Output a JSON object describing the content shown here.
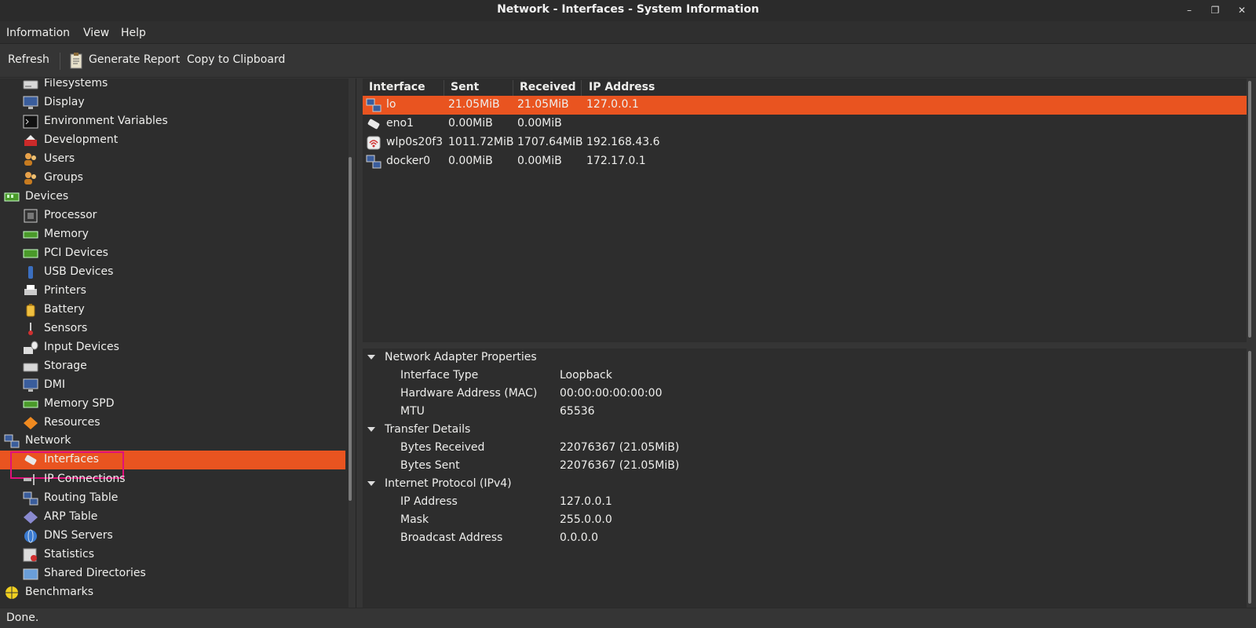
{
  "window": {
    "title": "Network - Interfaces - System Information"
  },
  "menubar": {
    "items": [
      "Information",
      "View",
      "Help"
    ]
  },
  "toolbar": {
    "refresh": "Refresh",
    "generate_report": "Generate Report",
    "copy_clipboard": "Copy to Clipboard"
  },
  "sidebar": {
    "items": [
      {
        "label": "Filesystems",
        "icon": "filesystem-icon",
        "level": 1
      },
      {
        "label": "Display",
        "icon": "display-icon",
        "level": 1
      },
      {
        "label": "Environment Variables",
        "icon": "terminal-icon",
        "level": 1
      },
      {
        "label": "Development",
        "icon": "development-icon",
        "level": 1
      },
      {
        "label": "Users",
        "icon": "users-icon",
        "level": 1
      },
      {
        "label": "Groups",
        "icon": "groups-icon",
        "level": 1
      },
      {
        "label": "Devices",
        "icon": "devices-icon",
        "level": 0
      },
      {
        "label": "Processor",
        "icon": "processor-icon",
        "level": 1
      },
      {
        "label": "Memory",
        "icon": "memory-icon",
        "level": 1
      },
      {
        "label": "PCI Devices",
        "icon": "pci-icon",
        "level": 1
      },
      {
        "label": "USB Devices",
        "icon": "usb-icon",
        "level": 1
      },
      {
        "label": "Printers",
        "icon": "printer-icon",
        "level": 1
      },
      {
        "label": "Battery",
        "icon": "battery-icon",
        "level": 1
      },
      {
        "label": "Sensors",
        "icon": "sensor-icon",
        "level": 1
      },
      {
        "label": "Input Devices",
        "icon": "input-devices-icon",
        "level": 1
      },
      {
        "label": "Storage",
        "icon": "storage-icon",
        "level": 1
      },
      {
        "label": "DMI",
        "icon": "dmi-icon",
        "level": 1
      },
      {
        "label": "Memory SPD",
        "icon": "memory-spd-icon",
        "level": 1
      },
      {
        "label": "Resources",
        "icon": "resources-icon",
        "level": 1
      },
      {
        "label": "Network",
        "icon": "network-icon",
        "level": 0
      },
      {
        "label": "Interfaces",
        "icon": "interfaces-icon",
        "level": 1,
        "selected": true
      },
      {
        "label": "IP Connections",
        "icon": "ip-connections-icon",
        "level": 1
      },
      {
        "label": "Routing Table",
        "icon": "routing-icon",
        "level": 1
      },
      {
        "label": "ARP Table",
        "icon": "arp-icon",
        "level": 1
      },
      {
        "label": "DNS Servers",
        "icon": "dns-icon",
        "level": 1
      },
      {
        "label": "Statistics",
        "icon": "statistics-icon",
        "level": 1
      },
      {
        "label": "Shared Directories",
        "icon": "shared-folder-icon",
        "level": 1
      },
      {
        "label": "Benchmarks",
        "icon": "benchmarks-icon",
        "level": 0
      }
    ]
  },
  "interfaces": {
    "columns": [
      "Interface",
      "Sent",
      "Received",
      "IP Address"
    ],
    "rows": [
      {
        "name": "lo",
        "sent": "21.05MiB",
        "received": "21.05MiB",
        "ip": "127.0.0.1",
        "icon": "network-icon",
        "selected": true
      },
      {
        "name": "eno1",
        "sent": "0.00MiB",
        "received": "0.00MiB",
        "ip": "",
        "icon": "ethernet-icon"
      },
      {
        "name": "wlp0s20f3",
        "sent": "1011.72MiB",
        "received": "1707.64MiB",
        "ip": "192.168.43.6",
        "icon": "wifi-icon"
      },
      {
        "name": "docker0",
        "sent": "0.00MiB",
        "received": "0.00MiB",
        "ip": "172.17.0.1",
        "icon": "network-icon"
      }
    ]
  },
  "details": {
    "sections": [
      {
        "title": "Network Adapter Properties",
        "rows": [
          {
            "key": "Interface Type",
            "value": "Loopback"
          },
          {
            "key": "Hardware Address (MAC)",
            "value": "00:00:00:00:00:00"
          },
          {
            "key": "MTU",
            "value": "65536"
          }
        ]
      },
      {
        "title": "Transfer Details",
        "rows": [
          {
            "key": "Bytes Received",
            "value": "22076367 (21.05MiB)"
          },
          {
            "key": "Bytes Sent",
            "value": "22076367 (21.05MiB)"
          }
        ]
      },
      {
        "title": "Internet Protocol (IPv4)",
        "rows": [
          {
            "key": "IP Address",
            "value": "127.0.0.1"
          },
          {
            "key": "Mask",
            "value": "255.0.0.0"
          },
          {
            "key": "Broadcast Address",
            "value": "0.0.0.0"
          }
        ]
      }
    ]
  },
  "status": {
    "text": "Done."
  },
  "colors": {
    "accent": "#e95420",
    "highlight_box": "#e0117a"
  }
}
